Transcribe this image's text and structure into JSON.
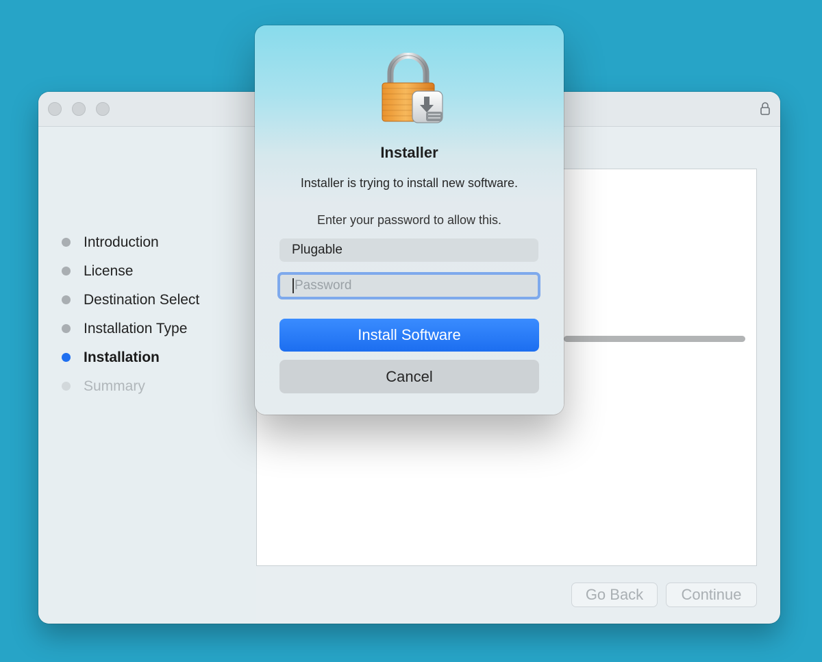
{
  "colors": {
    "desktop": "#27a4c7",
    "accent": "#1f6ff0",
    "primary_button": "#2a7cf7"
  },
  "window": {
    "steps": [
      {
        "label": "Introduction",
        "state": "done"
      },
      {
        "label": "License",
        "state": "done"
      },
      {
        "label": "Destination Select",
        "state": "done"
      },
      {
        "label": "Installation Type",
        "state": "done"
      },
      {
        "label": "Installation",
        "state": "active"
      },
      {
        "label": "Summary",
        "state": "future"
      }
    ],
    "progress": 1.0,
    "go_back_label": "Go Back",
    "continue_label": "Continue"
  },
  "dialog": {
    "title": "Installer",
    "message": "Installer is trying to install new software.",
    "prompt": "Enter your password to allow this.",
    "username": "Plugable",
    "password_placeholder": "Password",
    "install_label": "Install Software",
    "cancel_label": "Cancel"
  }
}
